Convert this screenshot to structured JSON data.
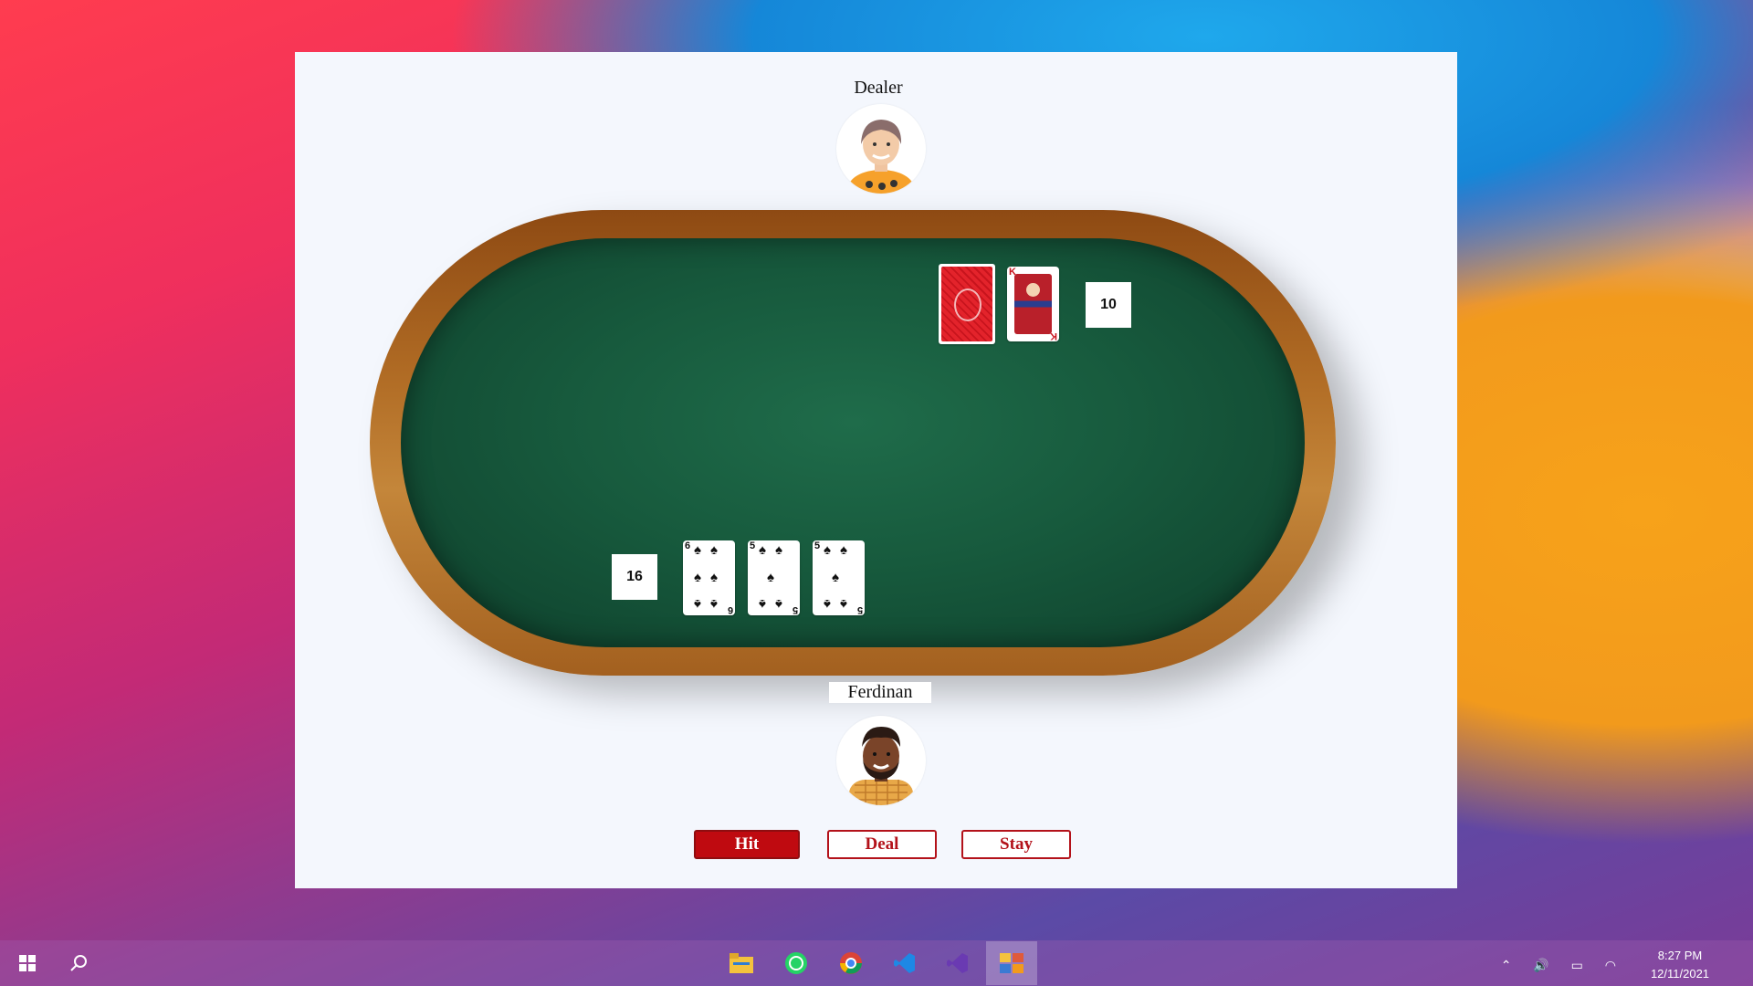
{
  "dealer": {
    "label": "Dealer",
    "score": "10",
    "cards": [
      {
        "face": "back"
      },
      {
        "rank": "K",
        "suit": "hearts"
      }
    ]
  },
  "player": {
    "label": "Ferdinan",
    "score": "16",
    "cards": [
      {
        "rank": "6",
        "suit": "spades"
      },
      {
        "rank": "5",
        "suit": "spades"
      },
      {
        "rank": "5",
        "suit": "spades"
      }
    ]
  },
  "buttons": {
    "hit": "Hit",
    "deal": "Deal",
    "stay": "Stay"
  },
  "taskbar": {
    "apps": [
      "start-icon",
      "search-icon",
      "file-explorer-icon",
      "whatsapp-icon",
      "chrome-icon",
      "vscode-icon",
      "visual-studio-icon",
      "app-window-icon"
    ],
    "time": "8:27 PM",
    "date": "12/11/2021"
  },
  "colors": {
    "felt": "#175a3d",
    "wood": "#b06b24",
    "button_red": "#bf0a10"
  }
}
